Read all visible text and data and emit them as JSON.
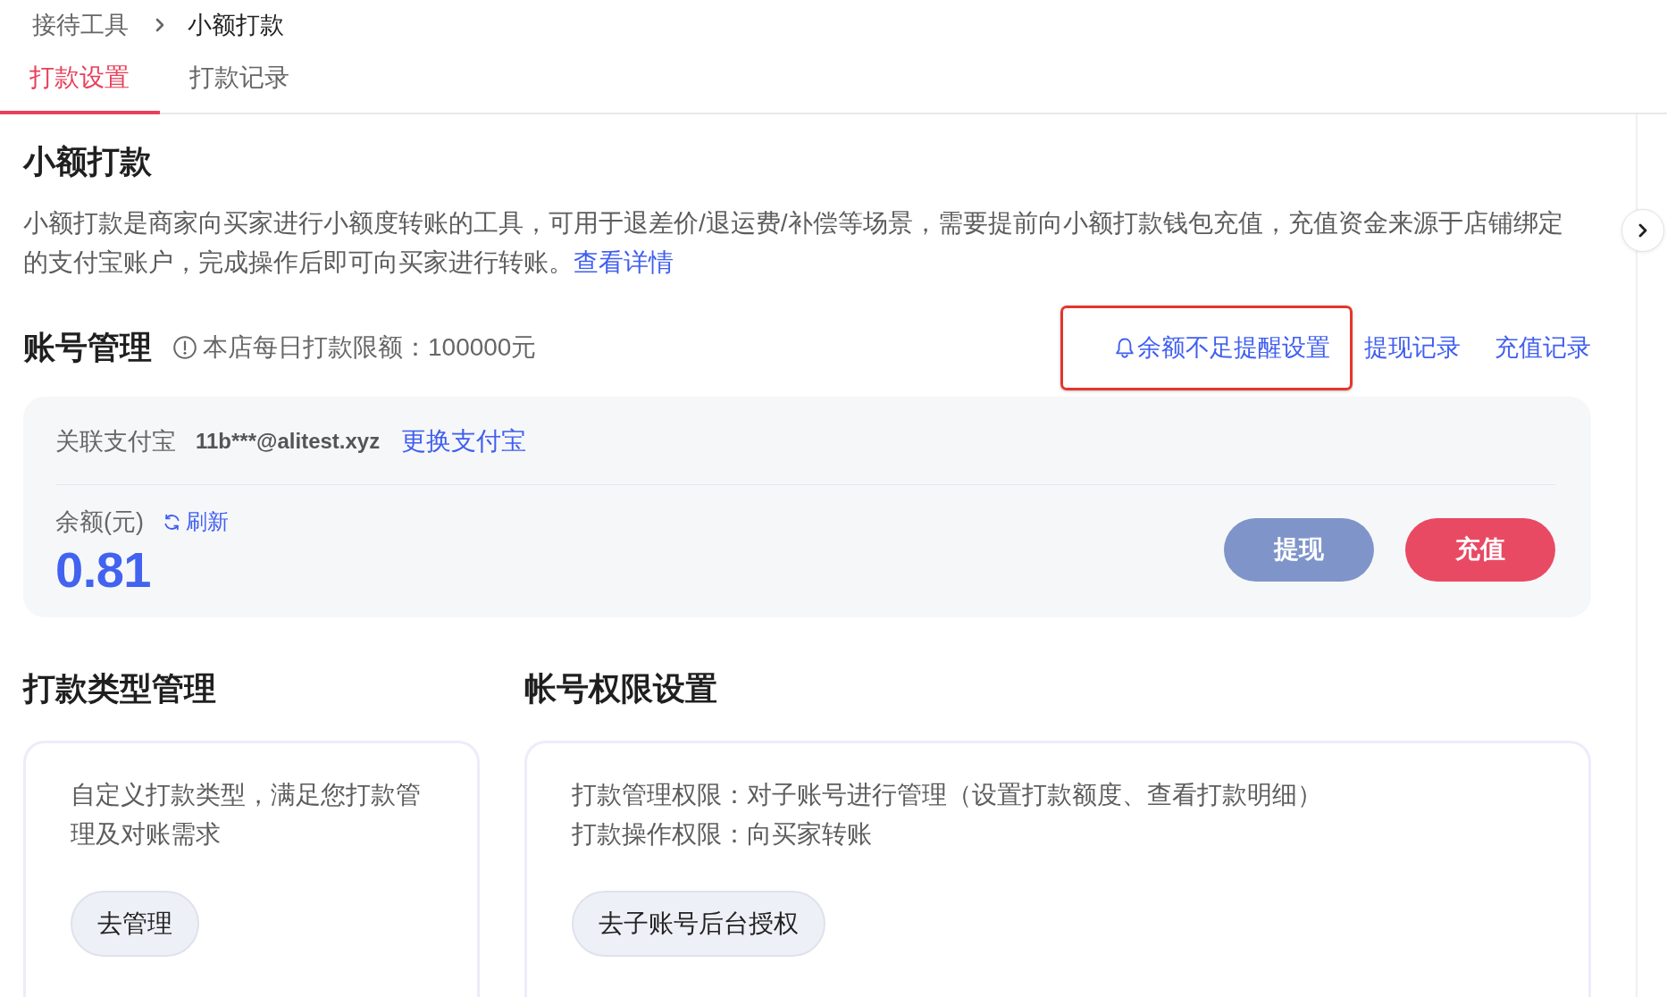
{
  "breadcrumb": [
    {
      "label": "接待工具"
    },
    {
      "label": "小额打款"
    }
  ],
  "tabs": [
    {
      "label": "打款设置",
      "selected": true
    },
    {
      "label": "打款记录",
      "selected": false
    }
  ],
  "intro": {
    "title": "小额打款",
    "description": "小额打款是商家向买家进行小额度转账的工具，可用于退差价/退运费/补偿等场景，需要提前向小额打款钱包充值，充值资金来源于店铺绑定的支付宝账户，完成操作后即可向买家进行转账。",
    "link": "查看详情"
  },
  "account": {
    "title": "账号管理",
    "limit_note": "本店每日打款限额：100000元",
    "links": [
      {
        "label": "余额不足提醒设置",
        "kind": "icon",
        "highlighted": true
      },
      {
        "label": "提现记录",
        "kind": "plain",
        "highlighted": false
      },
      {
        "label": "充值记录",
        "kind": "plain",
        "highlighted": false
      }
    ],
    "alipay_label": "关联支付宝",
    "alipay_account": "11b***@alitest.xyz",
    "change_link": "更换支付宝",
    "balance_label": "余额(元)",
    "refresh": "刷新",
    "balance": "0.81",
    "buttons": [
      {
        "label": "提现",
        "kind": "secondary"
      },
      {
        "label": "充值",
        "kind": "primary"
      }
    ]
  },
  "payment_types": {
    "title": "打款类型管理",
    "description": "自定义打款类型，满足您打款管理及对账需求",
    "button": "去管理"
  },
  "permissions": {
    "title": "帐号权限设置",
    "lines": [
      "打款管理权限：对子账号进行管理（设置打款额度、查看打款明细）",
      "打款操作权限：向买家转账"
    ],
    "button": "去子账号后台授权"
  }
}
